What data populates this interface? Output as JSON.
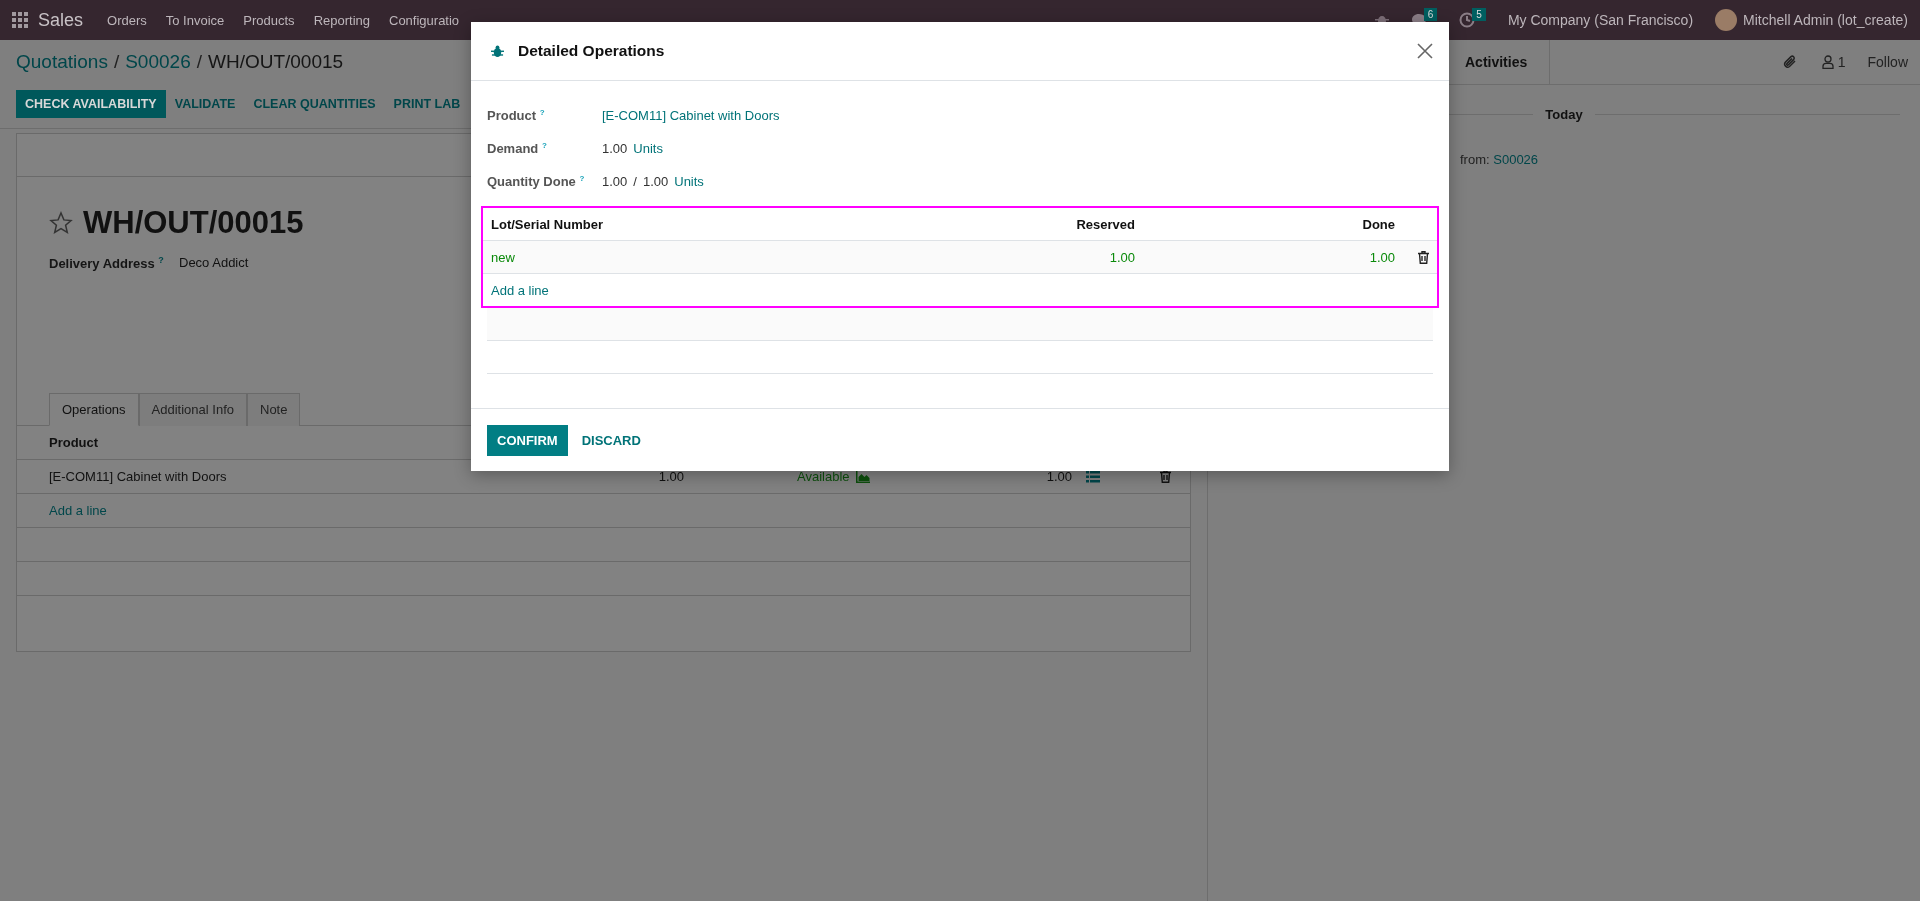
{
  "navbar": {
    "app": "Sales",
    "menu": [
      "Orders",
      "To Invoice",
      "Products",
      "Reporting",
      "Configuratio"
    ],
    "messages_count": "6",
    "activities_count": "5",
    "company": "My Company (San Francisco)",
    "user": "Mitchell Admin (lot_create)"
  },
  "breadcrumbs": {
    "items": [
      "Quotations",
      "S00026",
      "WH/OUT/00015"
    ],
    "separator": "/"
  },
  "actions": [
    {
      "label": "CHECK AVAILABILITY",
      "kind": "primary"
    },
    {
      "label": "VALIDATE",
      "kind": "secondary"
    },
    {
      "label": "CLEAR QUANTITIES",
      "kind": "secondary"
    },
    {
      "label": "PRINT LAB",
      "kind": "secondary"
    }
  ],
  "record": {
    "title": "WH/OUT/00015",
    "starred": false,
    "fields": [
      {
        "label": "Delivery Address",
        "help": "?",
        "value": "Deco Addict"
      }
    ],
    "tabs": [
      {
        "label": "Operations",
        "selected": true
      },
      {
        "label": "Additional Info",
        "selected": false
      },
      {
        "label": "Note",
        "selected": false
      }
    ],
    "operations": {
      "columns": [
        "Product"
      ],
      "rows": [
        {
          "product": "[E-COM11] Cabinet with Doors",
          "column_2": "1.00",
          "availability": "Available",
          "column_4": "1.00"
        }
      ],
      "add_line": "Add a line"
    }
  },
  "chatter": {
    "activities": "Activities",
    "followers": "1",
    "follow": "Follow",
    "date_separator": "Today",
    "message": {
      "text": "from:",
      "link": "S00026"
    }
  },
  "dialog": {
    "title": "Detailed Operations",
    "fields": [
      {
        "label": "Product",
        "help": "?",
        "parts": [
          {
            "text": "[E-COM11] Cabinet with Doors",
            "kind": "link"
          }
        ]
      },
      {
        "label": "Demand",
        "help": "?",
        "parts": [
          {
            "text": "1.00",
            "kind": "text"
          },
          {
            "text": "Units",
            "kind": "link"
          }
        ]
      },
      {
        "label": "Quantity Done",
        "help": "?",
        "parts": [
          {
            "text": "1.00",
            "kind": "text"
          },
          {
            "text": "/",
            "kind": "text"
          },
          {
            "text": "1.00",
            "kind": "text"
          },
          {
            "text": "Units",
            "kind": "link"
          }
        ]
      }
    ],
    "table": {
      "highlighted": true,
      "columns": [
        "Lot/Serial Number",
        "Reserved",
        "Done"
      ],
      "rows": [
        {
          "lot": "new",
          "reserved": "1.00",
          "done": "1.00"
        }
      ],
      "add_line": "Add a line"
    },
    "buttons": [
      {
        "label": "CONFIRM",
        "kind": "primary"
      },
      {
        "label": "DISCARD",
        "kind": "secondary"
      }
    ]
  }
}
